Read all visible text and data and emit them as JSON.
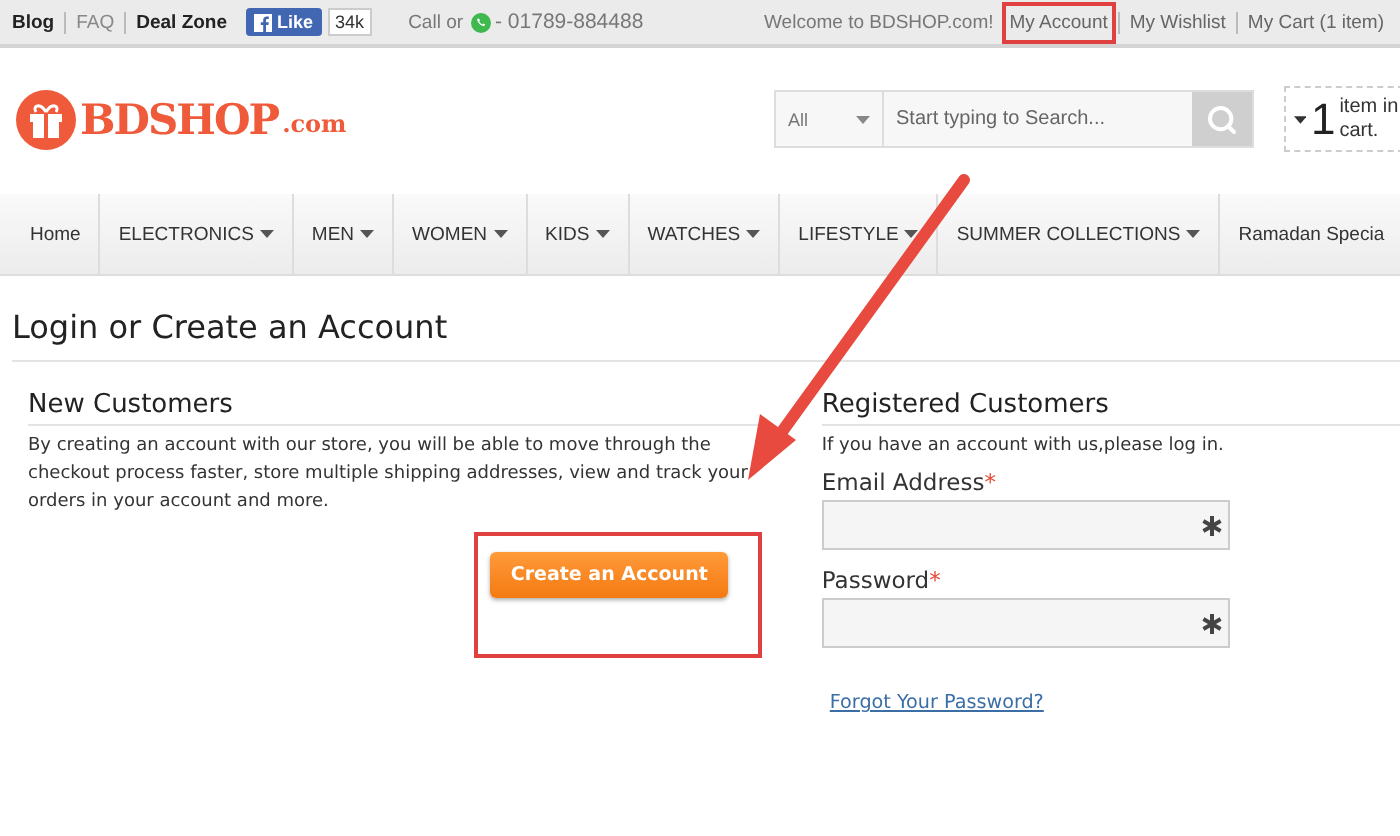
{
  "top_bar": {
    "left_links": [
      {
        "label": "Blog",
        "bold": true
      },
      {
        "label": "FAQ",
        "bold": false
      },
      {
        "label": "Deal Zone",
        "bold": true
      }
    ],
    "like_button": {
      "label": "Like",
      "count": "34k"
    },
    "call": {
      "prefix": "Call or",
      "number": "- 01789-884488"
    },
    "welcome": "Welcome to BDSHOP.com!",
    "account_links": [
      {
        "label": "My Account",
        "highlighted": true
      },
      {
        "label": "My Wishlist",
        "highlighted": false
      },
      {
        "label": "My Cart (1 item)",
        "highlighted": false
      }
    ]
  },
  "logo": {
    "name": "BDSHOP",
    "suffix": ".com"
  },
  "search": {
    "category": "All",
    "placeholder": "Start typing to Search..."
  },
  "cart": {
    "count": "1",
    "text": "item in cart."
  },
  "nav": [
    {
      "label": "Home",
      "has_menu": false
    },
    {
      "label": "ELECTRONICS",
      "has_menu": true
    },
    {
      "label": "MEN",
      "has_menu": true
    },
    {
      "label": "WOMEN",
      "has_menu": true
    },
    {
      "label": "KIDS",
      "has_menu": true
    },
    {
      "label": "WATCHES",
      "has_menu": true
    },
    {
      "label": "LIFESTYLE",
      "has_menu": true
    },
    {
      "label": "SUMMER COLLECTIONS",
      "has_menu": true
    },
    {
      "label": "Ramadan Specia",
      "has_menu": false
    }
  ],
  "page_title": "Login or Create an Account",
  "new_customers": {
    "heading": "New Customers",
    "text": "By creating an account with our store, you will be able to move through the checkout process faster, store multiple shipping addresses, view and track your orders in your account and more.",
    "button": {
      "label": "Create an Account",
      "highlighted": true
    }
  },
  "registered_customers": {
    "heading": "Registered Customers",
    "intro": "If you have an account with us,please log in.",
    "fields": [
      {
        "label": "Email Address",
        "required_mark": "*"
      },
      {
        "label": "Password",
        "required_mark": "*"
      }
    ],
    "forgot_link": "Forgot Your Password?"
  },
  "annotation": {
    "kind": "arrow"
  }
}
